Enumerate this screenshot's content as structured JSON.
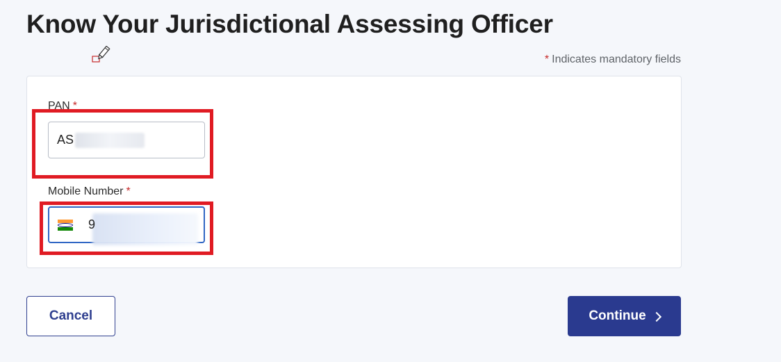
{
  "page": {
    "title": "Know Your Jurisdictional Assessing Officer",
    "mandatory_star": "*",
    "mandatory_note": "Indicates mandatory fields"
  },
  "form": {
    "pan": {
      "label": "PAN",
      "required_marker": "*",
      "value_visible": "AS"
    },
    "mobile": {
      "label": "Mobile Number",
      "required_marker": "*",
      "country_flag_icon": "india-flag-icon",
      "value_visible": "9"
    }
  },
  "actions": {
    "cancel_label": "Cancel",
    "continue_label": "Continue"
  },
  "colors": {
    "primary": "#2a3a8f",
    "highlight": "#e01b23",
    "required": "#c62828",
    "focus_border": "#2f66c4"
  },
  "icons": {
    "cursor": "pencil-icon",
    "continue": "chevron-right-icon"
  }
}
